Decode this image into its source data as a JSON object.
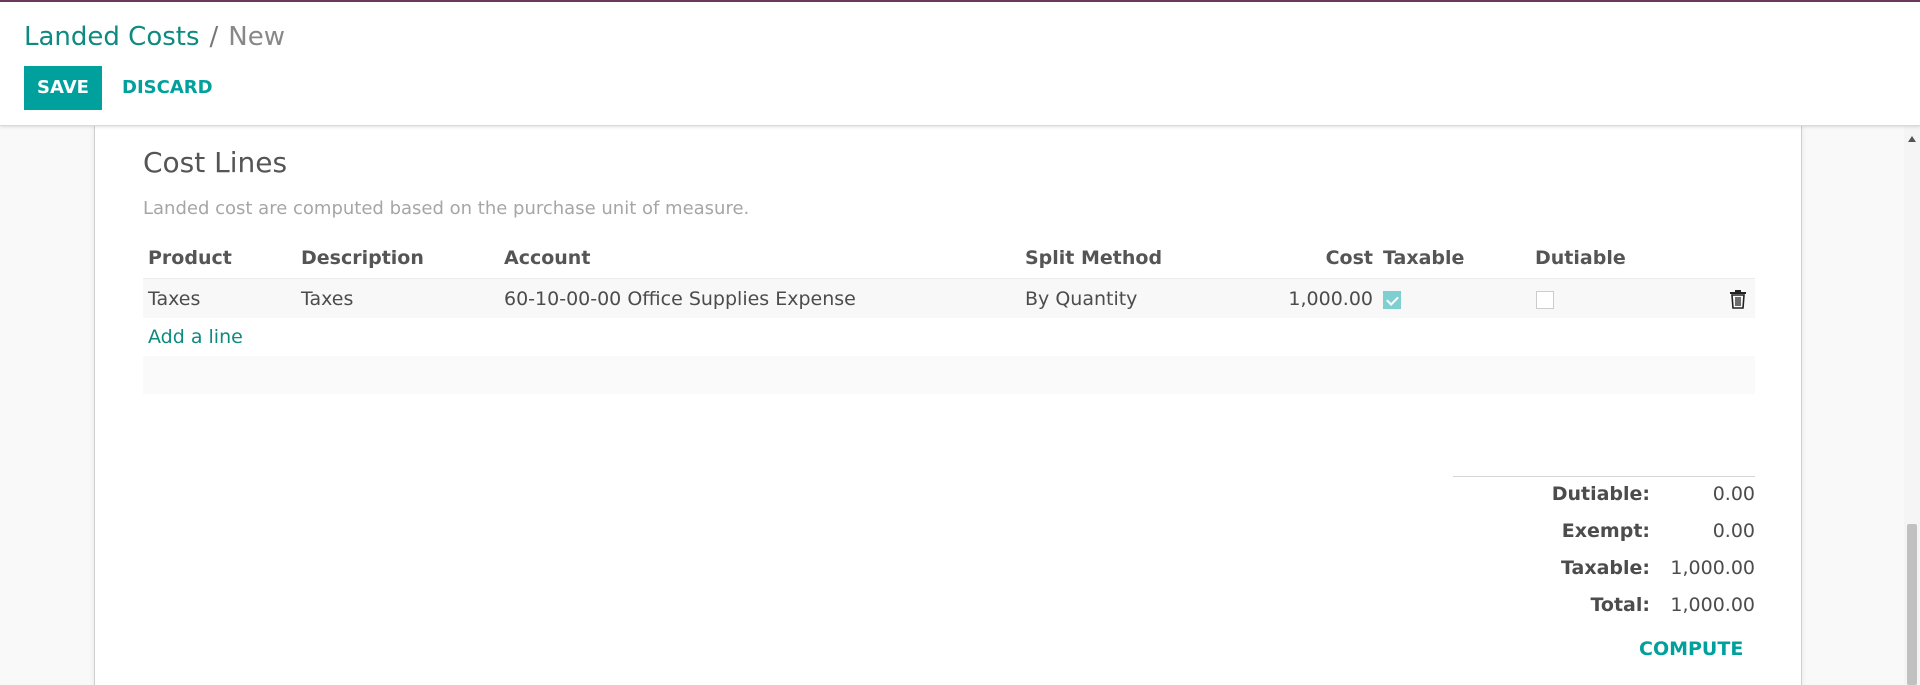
{
  "breadcrumb": {
    "parent": "Landed Costs",
    "separator": "/",
    "current": "New"
  },
  "actions": {
    "save": "SAVE",
    "discard": "DISCARD"
  },
  "cost_lines": {
    "title": "Cost Lines",
    "help": "Landed cost are computed based on the purchase unit of measure.",
    "columns": {
      "product": "Product",
      "description": "Description",
      "account": "Account",
      "split_method": "Split Method",
      "cost": "Cost",
      "taxable": "Taxable",
      "dutiable": "Dutiable"
    },
    "rows": [
      {
        "product": "Taxes",
        "description": "Taxes",
        "account": "60-10-00-00 Office Supplies Expense",
        "split_method": "By Quantity",
        "cost": "1,000.00",
        "taxable": true,
        "dutiable": false
      }
    ],
    "add_line": "Add a line"
  },
  "totals": {
    "dutiable": {
      "label": "Dutiable:",
      "value": "0.00"
    },
    "exempt": {
      "label": "Exempt:",
      "value": "0.00"
    },
    "taxable": {
      "label": "Taxable:",
      "value": "1,000.00"
    },
    "total": {
      "label": "Total:",
      "value": "1,000.00"
    }
  },
  "compute": "COMPUTE",
  "colors": {
    "accent": "#00a09d",
    "link": "#0f8a80",
    "topbar": "#6b3a5f",
    "checkbox_checked": "#7fcfd0"
  },
  "icons": {
    "delete": "trash-icon",
    "checkbox": "checkbox-icon",
    "scroll_up": "chevron-up-icon"
  }
}
